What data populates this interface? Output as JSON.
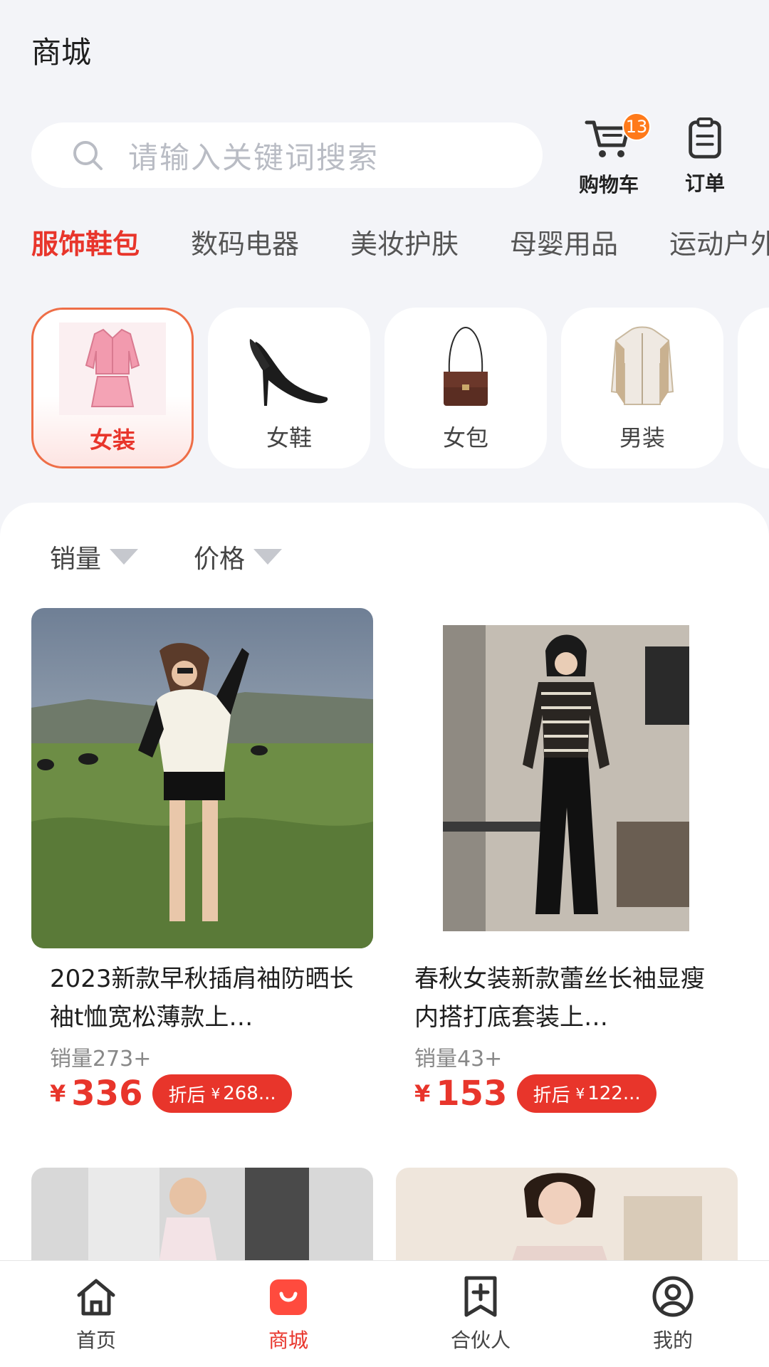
{
  "header": {
    "title": "商城"
  },
  "search": {
    "placeholder": "请输入关键词搜索"
  },
  "cart": {
    "label": "购物车",
    "badge": "13"
  },
  "order": {
    "label": "订单"
  },
  "tabs": [
    {
      "label": "服饰鞋包",
      "active": true
    },
    {
      "label": "数码电器"
    },
    {
      "label": "美妆护肤"
    },
    {
      "label": "母婴用品"
    },
    {
      "label": "运动户外"
    }
  ],
  "subcategories": [
    {
      "label": "女装",
      "icon": "women-clothing-icon",
      "active": true
    },
    {
      "label": "女鞋",
      "icon": "high-heel-icon"
    },
    {
      "label": "女包",
      "icon": "handbag-icon"
    },
    {
      "label": "男装",
      "icon": "jacket-icon"
    }
  ],
  "sort": {
    "sales": "销量",
    "price": "价格"
  },
  "products": [
    {
      "title": "2023新款早秋插肩袖防晒长袖t恤宽松薄款上…",
      "sales": "销量273+",
      "currency": "¥",
      "price": "336",
      "discount_prefix": "折后",
      "discount_currency": "¥",
      "discount_price": "268..."
    },
    {
      "title": "春秋女装新款蕾丝长袖显瘦内搭打底套装上…",
      "sales": "销量43+",
      "currency": "¥",
      "price": "153",
      "discount_prefix": "折后",
      "discount_currency": "¥",
      "discount_price": "122..."
    }
  ],
  "bottom_nav": [
    {
      "label": "首页",
      "icon": "home-icon"
    },
    {
      "label": "商城",
      "icon": "mall-icon",
      "active": true
    },
    {
      "label": "合伙人",
      "icon": "partner-icon"
    },
    {
      "label": "我的",
      "icon": "profile-icon"
    }
  ],
  "colors": {
    "accent": "#e8352b",
    "badge": "#ff7a1a",
    "background": "#f3f4f8"
  }
}
